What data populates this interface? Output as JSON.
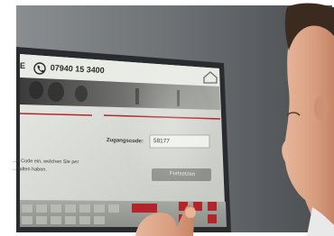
{
  "kiosk": {
    "phone_number": "07940 15 3400",
    "access_code_label": "Zugangscode:",
    "access_code_value": "58177",
    "instruction_line1": "...n Code ein, welchen Sie per",
    "instruction_line2": "...halten haben.",
    "submit_button_label": "Fortsetzen",
    "left_fragment": "E"
  },
  "colors": {
    "screen_bezel": "#2a2b2f",
    "screen_glass": "#d9dcd6",
    "accent_red": "#b0262a",
    "wall_background": "#5f6366"
  },
  "icons": [
    "phone-icon",
    "home-icon"
  ]
}
